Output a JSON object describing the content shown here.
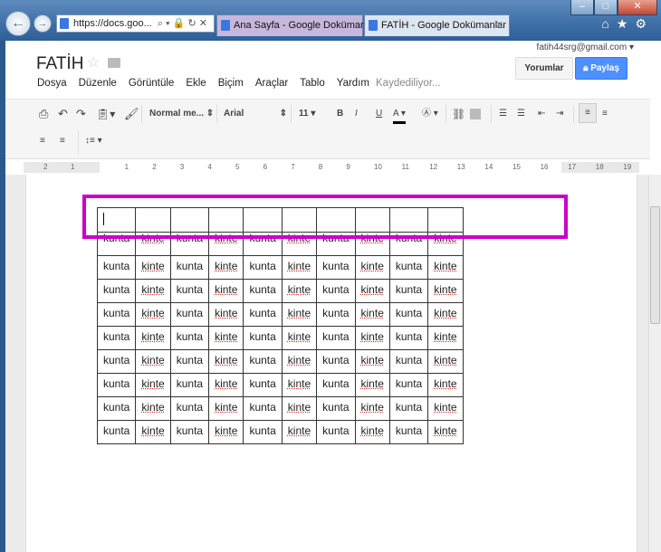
{
  "browser": {
    "address": "https://docs.goo...",
    "tabs": [
      {
        "label": "Ana Sayfa - Google Dokümanlar"
      },
      {
        "label": "FATİH - Google Dokümanlar",
        "active": true
      }
    ]
  },
  "doc": {
    "title": "FATİH",
    "account": "fatih44srg@gmail.com",
    "comments_label": "Yorumlar",
    "share_label": "Paylaş",
    "save_status": "Kaydediliyor..."
  },
  "menu": [
    "Dosya",
    "Düzenle",
    "Görüntüle",
    "Ekle",
    "Biçim",
    "Araçlar",
    "Tablo",
    "Yardım"
  ],
  "toolbar": {
    "style": "Normal me...",
    "font": "Arial",
    "size": "11"
  },
  "ruler": [
    "2",
    "1",
    "1",
    "2",
    "3",
    "4",
    "5",
    "6",
    "7",
    "8",
    "9",
    "10",
    "11",
    "12",
    "13",
    "14",
    "15",
    "16",
    "17",
    "18",
    "19"
  ],
  "table": {
    "header_row": [
      "",
      "",
      "",
      "",
      "",
      "",
      "",
      "",
      "",
      ""
    ],
    "rows": [
      [
        "kunta",
        "kinte",
        "kunta",
        "kinte",
        "kunta",
        "kinte",
        "kunta",
        "kinte",
        "kunta",
        "kinte"
      ],
      [
        "kunta",
        "kinte",
        "kunta",
        "kinte",
        "kunta",
        "kinte",
        "kunta",
        "kinte",
        "kunta",
        "kinte"
      ],
      [
        "kunta",
        "kinte",
        "kunta",
        "kinte",
        "kunta",
        "kinte",
        "kunta",
        "kinte",
        "kunta",
        "kinte"
      ],
      [
        "kunta",
        "kinte",
        "kunta",
        "kinte",
        "kunta",
        "kinte",
        "kunta",
        "kinte",
        "kunta",
        "kinte"
      ],
      [
        "kunta",
        "kinte",
        "kunta",
        "kinte",
        "kunta",
        "kinte",
        "kunta",
        "kinte",
        "kunta",
        "kinte"
      ],
      [
        "kunta",
        "kinte",
        "kunta",
        "kinte",
        "kunta",
        "kinte",
        "kunta",
        "kinte",
        "kunta",
        "kinte"
      ],
      [
        "kunta",
        "kinte",
        "kunta",
        "kinte",
        "kunta",
        "kinte",
        "kunta",
        "kinte",
        "kunta",
        "kinte"
      ],
      [
        "kunta",
        "kinte",
        "kunta",
        "kinte",
        "kunta",
        "kinte",
        "kunta",
        "kinte",
        "kunta",
        "kinte"
      ],
      [
        "kunta",
        "kinte",
        "kunta",
        "kinte",
        "kunta",
        "kinte",
        "kunta",
        "kinte",
        "kunta",
        "kinte"
      ]
    ]
  },
  "colors": {
    "highlight": "#cc00cc",
    "share": "#4d90fe"
  }
}
